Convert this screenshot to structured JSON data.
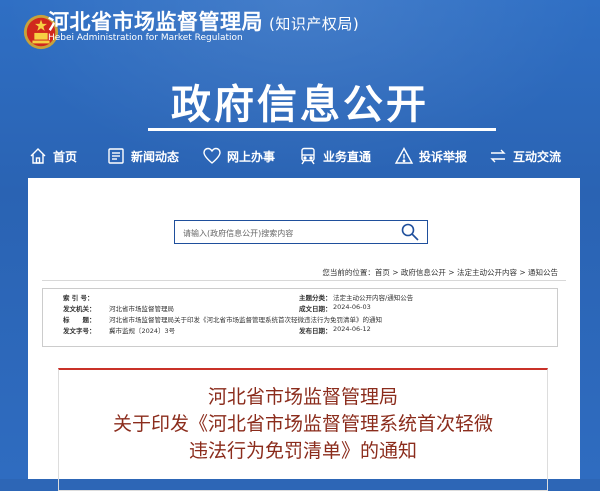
{
  "header": {
    "org_name": "河北省市场监督管理局",
    "org_sub": "(知识产权局)",
    "org_en": "Hebei Administration for Market Regulation",
    "banner": "政府信息公开"
  },
  "nav": [
    {
      "label": "首页",
      "icon": "home-icon"
    },
    {
      "label": "新闻动态",
      "icon": "news-icon"
    },
    {
      "label": "网上办事",
      "icon": "heart-hand-icon"
    },
    {
      "label": "业务直通",
      "icon": "train-icon"
    },
    {
      "label": "投诉举报",
      "icon": "warning-icon"
    },
    {
      "label": "互动交流",
      "icon": "exchange-icon"
    }
  ],
  "search": {
    "placeholder": "请输入(政府信息公开)搜索内容"
  },
  "breadcrumb": "您当前的位置：首页 > 政府信息公开 > 法定主动公开内容 > 通知公告",
  "meta": {
    "index_label": "索 引 号：",
    "index_value": "",
    "topic_label": "主题分类：",
    "topic_value": "法定主动公开内容/通知公告",
    "issuer_label": "发文机关：",
    "issuer_value": "河北省市场监督管理局",
    "created_label": "成文日期：",
    "created_value": "2024-06-03",
    "title_label": "标　　题：",
    "title_value": "河北省市场监督管理局关于印发《河北省市场监督管理系统首次轻微违法行为免罚清单》的通知",
    "docno_label": "发文字号：",
    "docno_value": "冀市监规〔2024〕3号",
    "pubdate_label": "发布日期：",
    "pubdate_value": "2024-06-12"
  },
  "doc": {
    "title_line1": "河北省市场监督管理局",
    "title_line2": "关于印发《河北省市场监督管理系统首次轻微",
    "title_line3": "违法行为免罚清单》的通知"
  }
}
